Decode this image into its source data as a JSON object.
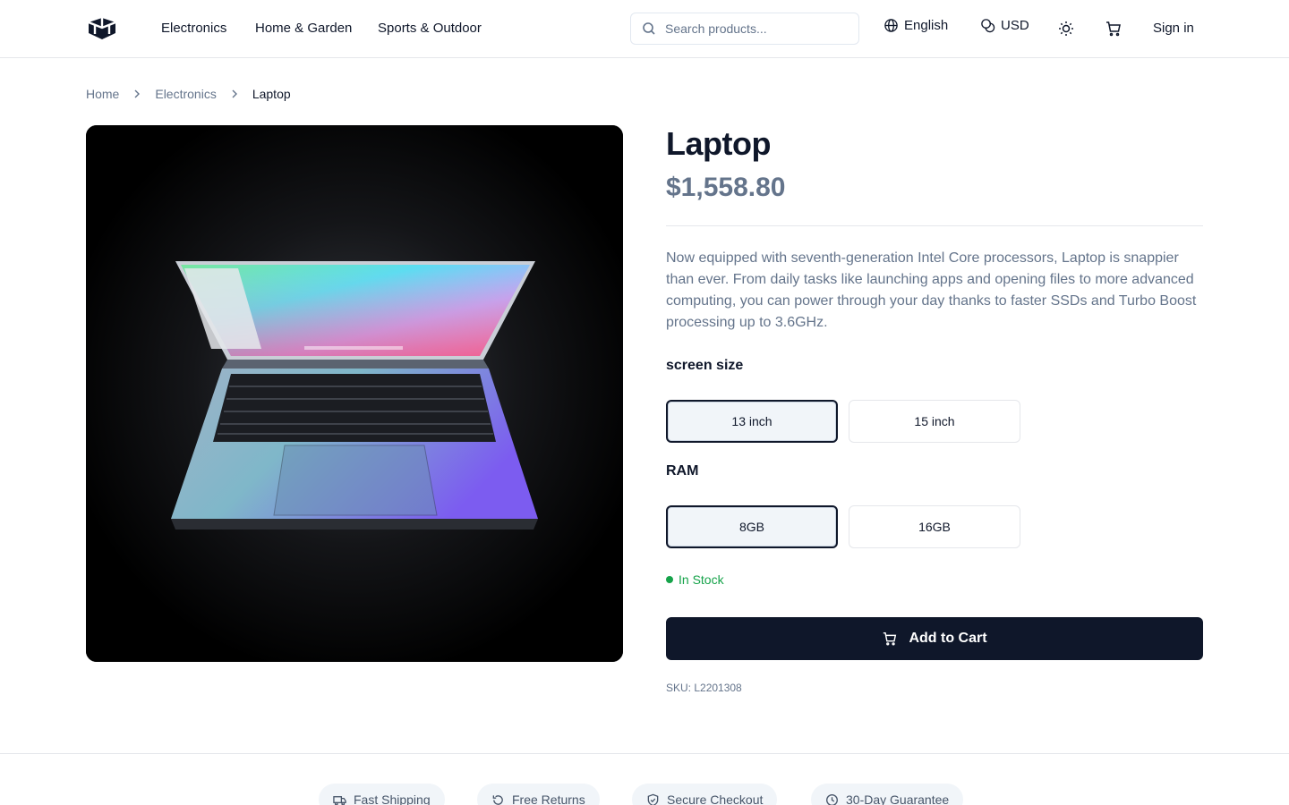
{
  "header": {
    "nav": [
      "Electronics",
      "Home & Garden",
      "Sports & Outdoor"
    ],
    "search_placeholder": "Search products...",
    "language": "English",
    "currency": "USD",
    "sign_in": "Sign in"
  },
  "breadcrumb": [
    "Home",
    "Electronics",
    "Laptop"
  ],
  "product": {
    "title": "Laptop",
    "price": "$1,558.80",
    "description": "Now equipped with seventh-generation Intel Core processors, Laptop is snappier than ever. From daily tasks like launching apps and opening files to more advanced computing, you can power through your day thanks to faster SSDs and Turbo Boost processing up to 3.6GHz.",
    "options": [
      {
        "label": "screen size",
        "values": [
          "13 inch",
          "15 inch"
        ],
        "selected": "13 inch"
      },
      {
        "label": "RAM",
        "values": [
          "8GB",
          "16GB"
        ],
        "selected": "8GB"
      }
    ],
    "stock": "In Stock",
    "add_to_cart": "Add to Cart",
    "sku": "SKU: L2201308"
  },
  "features": [
    "Fast Shipping",
    "Free Returns",
    "Secure Checkout",
    "30-Day Guarantee"
  ],
  "colors": {
    "primary": "#0f172a",
    "muted": "#64748b",
    "stock_green": "#16a34a",
    "border": "#e5e7eb"
  }
}
